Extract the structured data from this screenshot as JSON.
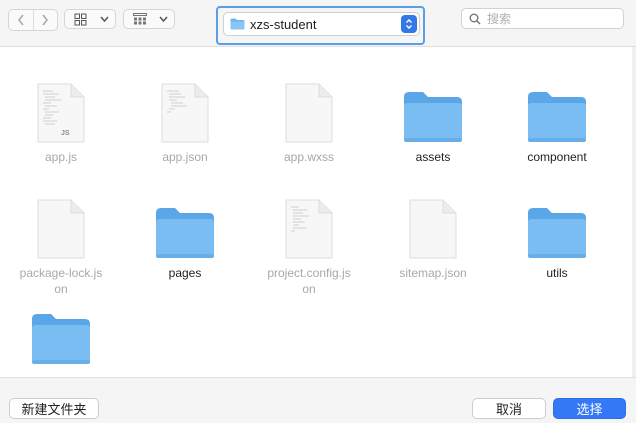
{
  "toolbar": {
    "back_icon": "chevron-left-icon",
    "forward_icon": "chevron-right-icon",
    "view_icon": "grid-view-icon",
    "group_icon": "group-view-icon",
    "path": "xzs-student",
    "search_placeholder": "搜索"
  },
  "files": [
    {
      "name": "app.js",
      "kind": "doc",
      "dim": true,
      "badge": "JS"
    },
    {
      "name": "app.json",
      "kind": "doc",
      "dim": true,
      "badge": ""
    },
    {
      "name": "app.wxss",
      "kind": "blank",
      "dim": true,
      "badge": ""
    },
    {
      "name": "assets",
      "kind": "folder",
      "dim": false
    },
    {
      "name": "component",
      "kind": "folder",
      "dim": false
    },
    {
      "name": "package-lock.json",
      "kind": "blank",
      "dim": true,
      "badge": ""
    },
    {
      "name": "pages",
      "kind": "folder",
      "dim": false
    },
    {
      "name": "project.config.json",
      "kind": "doc",
      "dim": true,
      "badge": ""
    },
    {
      "name": "sitemap.json",
      "kind": "blank",
      "dim": true,
      "badge": ""
    },
    {
      "name": "utils",
      "kind": "folder",
      "dim": false
    },
    {
      "name": "",
      "kind": "folder",
      "dim": false
    }
  ],
  "footer": {
    "new_folder": "新建文件夹",
    "cancel": "取消",
    "choose": "选择"
  },
  "colors": {
    "accent": "#3478f6",
    "folder": "#6fb4ef",
    "focus_ring": "#5b9ee8"
  }
}
